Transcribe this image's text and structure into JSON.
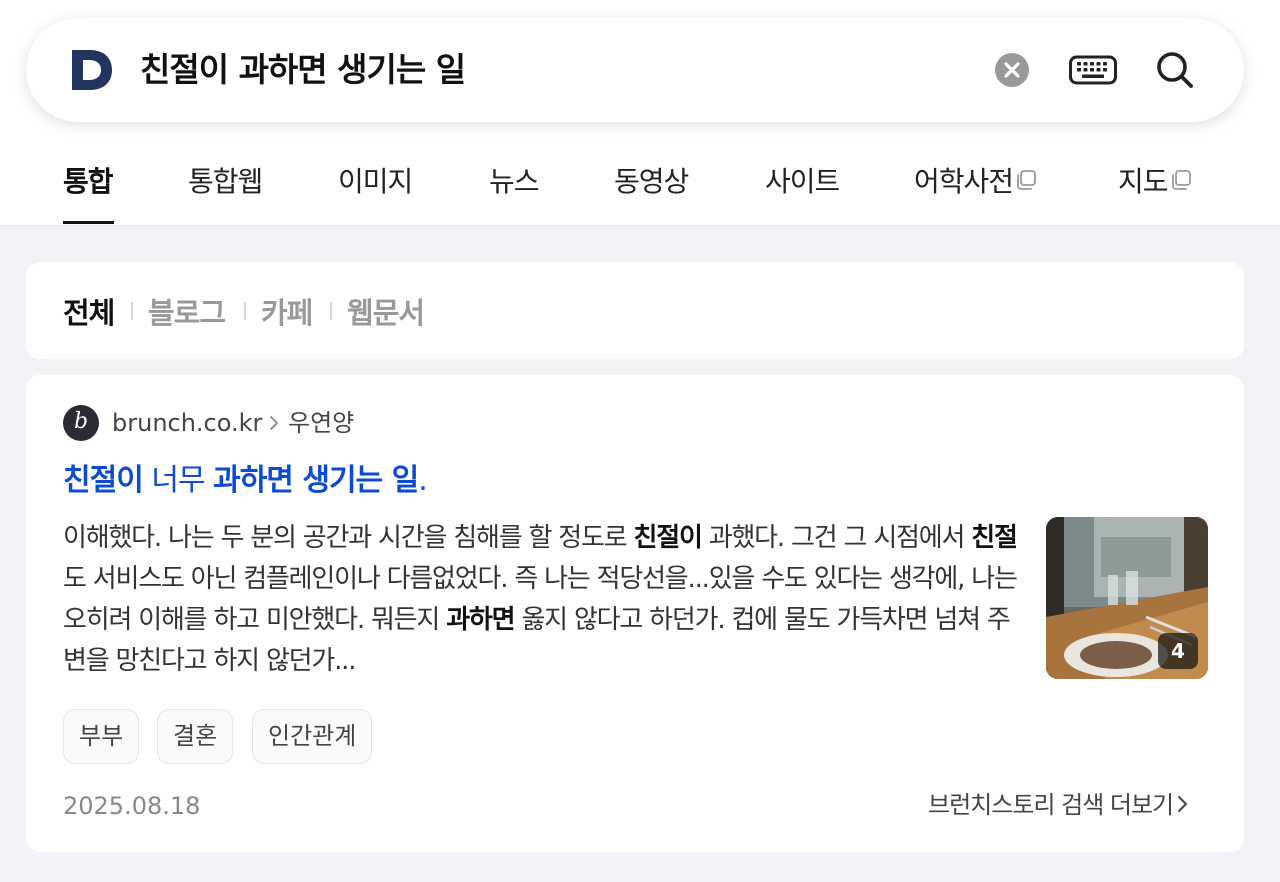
{
  "search": {
    "logo_letter": "D",
    "query": "친절이 과하면 생기는 일"
  },
  "tabs": [
    {
      "label": "통합",
      "active": true
    },
    {
      "label": "통합웹"
    },
    {
      "label": "이미지"
    },
    {
      "label": "뉴스"
    },
    {
      "label": "동영상"
    },
    {
      "label": "사이트"
    },
    {
      "label": "어학사전",
      "external": true
    },
    {
      "label": "지도",
      "external": true
    }
  ],
  "filters": [
    {
      "label": "전체",
      "active": true
    },
    {
      "label": "블로그"
    },
    {
      "label": "카페"
    },
    {
      "label": "웹문서"
    }
  ],
  "result": {
    "source": {
      "avatar_letter": "b",
      "domain": "brunch.co.kr",
      "author": "우연양"
    },
    "title": {
      "part1": "친절이",
      "part2": " 너무 ",
      "part3": "과하면 생기는 일",
      "part4": "."
    },
    "snippet": {
      "s1": "이해했다. 나는 두 분의 공간과 시간을 침해를 할 정도로 ",
      "b1": "친절이",
      "s2": " 과했다. 그건 그 시점에서 ",
      "b2": "친절",
      "s3": "도 서비스도 아닌 컴플레인이나 다름없었다. 즉 나는 적당선을...있을 수도 있다는 생각에, 나는 오히려 이해를 하고 미안했다. 뭐든지 ",
      "b3": "과하면",
      "s4": " 옳지 않다고 하던가. 컵에 물도 가득차면 넘쳐 주변을 망친다고 하지 않던가..."
    },
    "thumbnail_count": "4",
    "tags": [
      "부부",
      "결혼",
      "인간관계"
    ],
    "date": "2025.08.18",
    "more_label": "브런치스토리 검색 더보기"
  },
  "colors": {
    "title_link": "#0b4bd1",
    "page_background": "#f1f3f7",
    "logo": "#22355f"
  },
  "icons": [
    "logo-d-icon",
    "clear-icon",
    "keyboard-icon",
    "search-icon",
    "external-window-icon",
    "chevron-right-icon"
  ]
}
